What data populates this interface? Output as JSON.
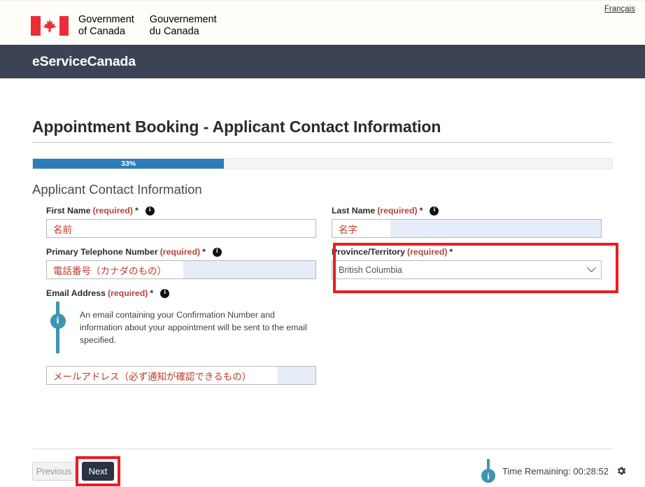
{
  "topbar": {
    "language_link": "Français",
    "wordmark_en_line1": "Government",
    "wordmark_en_line2": "of Canada",
    "wordmark_fr_line1": "Gouvernement",
    "wordmark_fr_line2": "du Canada",
    "flag_icon": "canada-flag-icon"
  },
  "appbar": {
    "title": "eServiceCanada"
  },
  "page": {
    "title": "Appointment Booking - Applicant Contact Information",
    "section_heading": "Applicant Contact Information"
  },
  "progress": {
    "label": "33%",
    "percent": 33,
    "fill_color": "#2e7cb8"
  },
  "fields": {
    "first_name": {
      "label": "First Name",
      "required_text": "(required)",
      "star": "*",
      "info_icon": "info-icon",
      "value": "名前",
      "placeholder": ""
    },
    "last_name": {
      "label": "Last Name",
      "required_text": "(required)",
      "star": "*",
      "info_icon": "info-icon",
      "value": "名字",
      "placeholder": ""
    },
    "telephone": {
      "label": "Primary Telephone Number",
      "required_text": "(required)",
      "star": "*",
      "info_icon": "info-icon",
      "value": "電話番号（カナダのもの）",
      "placeholder": ""
    },
    "province": {
      "label": "Province/Territory",
      "required_text": "(required)",
      "star": "*",
      "selected": "British Columbia",
      "chevron_icon": "chevron-down-icon",
      "highlight_color": "#ed1c24"
    },
    "email": {
      "label": "Email Address",
      "required_text": "(required)",
      "star": "*",
      "info_icon": "info-icon",
      "value": "メールアドレス（必ず通知が確認できるもの）",
      "placeholder": "",
      "callout_icon": "info-circle-icon",
      "callout_text": "An email containing your Confirmation Number and information about your appointment will be sent to the email specified."
    }
  },
  "footer": {
    "previous_label": "Previous",
    "next_label": "Next",
    "next_highlight_color": "#ed1c24",
    "timer_icon": "info-circle-icon",
    "timer_text": "Time Remaining: 00:28:52",
    "settings_icon": "gear-icon"
  }
}
